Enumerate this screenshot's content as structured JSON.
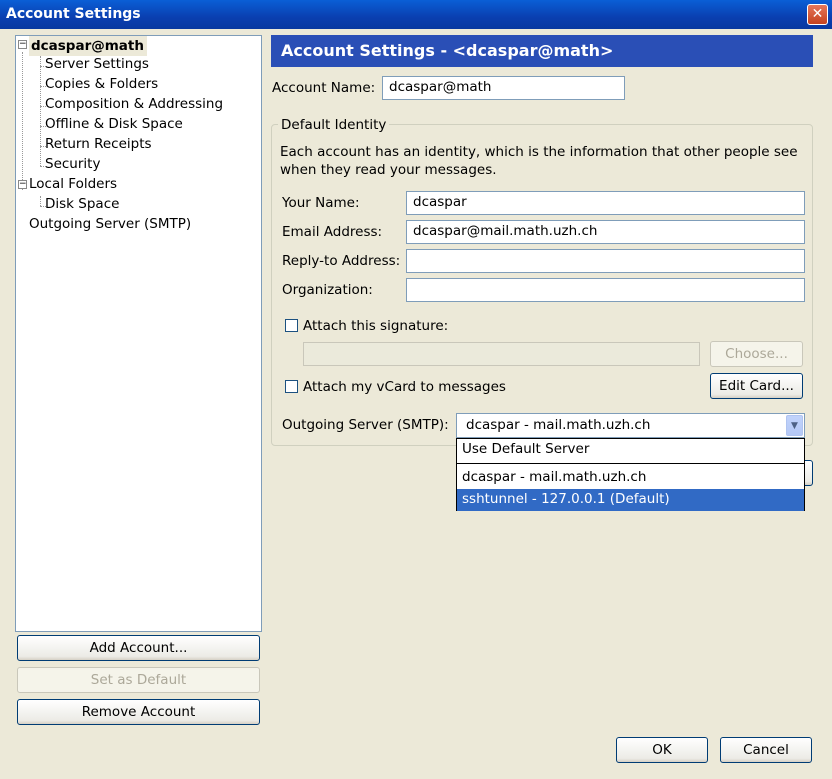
{
  "window": {
    "title": "Account Settings",
    "close_glyph": "✕"
  },
  "tree": {
    "account": "dcaspar@math",
    "account_children": [
      "Server Settings",
      "Copies & Folders",
      "Composition & Addressing",
      "Offline & Disk Space",
      "Return Receipts",
      "Security"
    ],
    "local_folders": "Local Folders",
    "local_children": [
      "Disk Space"
    ],
    "outgoing": "Outgoing Server (SMTP)",
    "expander_glyph": "−"
  },
  "left_buttons": {
    "add_account": "Add Account...",
    "set_default": "Set as Default",
    "remove_account": "Remove Account"
  },
  "panel": {
    "header": "Account Settings - <dcaspar@math>",
    "account_name_label": "Account Name:",
    "account_name_value": "dcaspar@math",
    "identity_legend": "Default Identity",
    "identity_desc": "Each account has an identity, which is the information that other people see when they read your messages.",
    "your_name_label": "Your Name:",
    "your_name_value": "dcaspar",
    "email_label": "Email Address:",
    "email_value": "dcaspar@mail.math.uzh.ch",
    "replyto_label": "Reply-to Address:",
    "replyto_value": "",
    "org_label": "Organization:",
    "org_value": "",
    "attach_signature_label": "Attach this signature:",
    "signature_path": "",
    "choose_button": "Choose...",
    "attach_vcard_label": "Attach my vCard to messages",
    "edit_card_button": "Edit Card...",
    "smtp_label": "Outgoing Server (SMTP):",
    "smtp_selected": "dcaspar - mail.math.uzh.ch",
    "dropdown_arrow": "▼",
    "smtp_options": [
      "Use Default Server",
      "dcaspar - mail.math.uzh.ch",
      "sshtunnel - 127.0.0.1 (Default)"
    ]
  },
  "footer": {
    "ok": "OK",
    "cancel": "Cancel"
  }
}
